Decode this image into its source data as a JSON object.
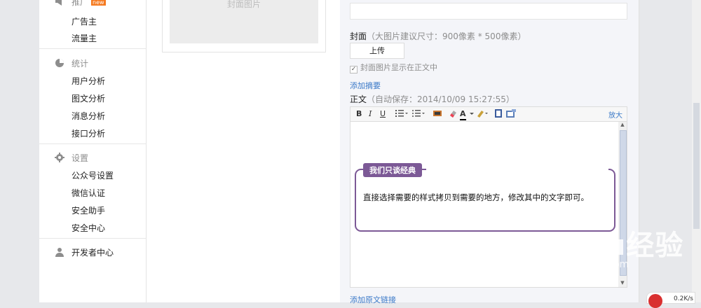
{
  "sidebar": {
    "promote": {
      "title": "推广",
      "badge": "new",
      "items": [
        "广告主",
        "流量主"
      ]
    },
    "stats": {
      "title": "统计",
      "items": [
        "用户分析",
        "图文分析",
        "消息分析",
        "接口分析"
      ]
    },
    "settings": {
      "title": "设置",
      "items": [
        "公众号设置",
        "微信认证",
        "安全助手",
        "安全中心"
      ]
    },
    "developer": {
      "title": "开发者中心"
    }
  },
  "preview": {
    "cover_placeholder": "封面图片"
  },
  "form": {
    "cover_label": "封面",
    "cover_hint": "（大图片建议尺寸：900像素 * 500像素）",
    "upload_label": "上传",
    "show_cover_label": "封面图片显示在正文中",
    "add_summary": "添加摘要",
    "body_label": "正文",
    "autosave": "（自动保存：2014/10/09 15:27:55）",
    "add_link": "添加原文链接"
  },
  "editor": {
    "toolbar": {
      "bold": "B",
      "italic": "I",
      "underline": "U",
      "enlarge": "放大"
    },
    "card": {
      "tag": "我们只谈经典",
      "text": "直接选择需要的样式拷贝到需要的地方，修改其中的文字即可。"
    }
  },
  "overlay": {
    "watermark": "Baidu经验",
    "watermark_sub": "jingyan.baidu.com",
    "speed": "0.2K/s"
  },
  "colors": {
    "accent": "#7c5996",
    "link": "#3a79c8"
  }
}
